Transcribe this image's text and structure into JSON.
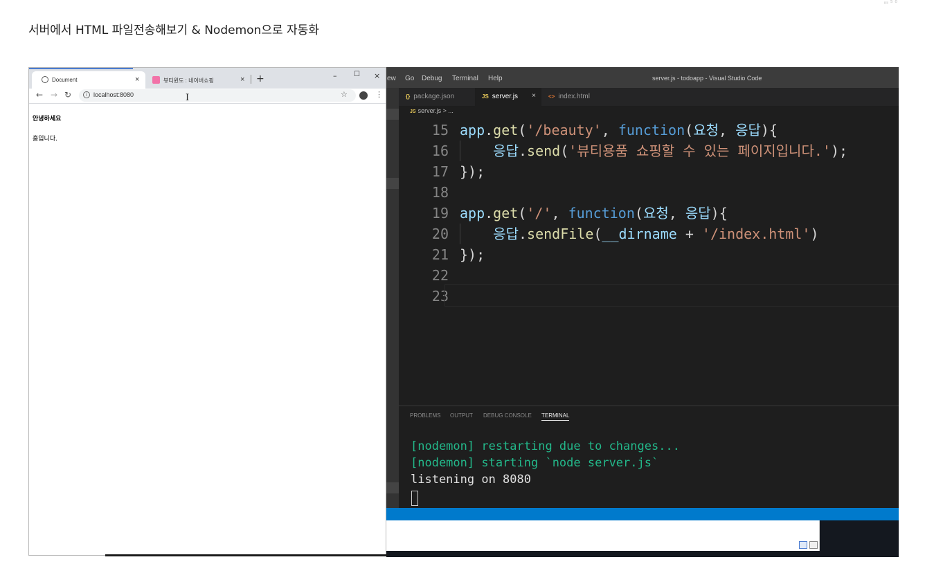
{
  "page": {
    "title": "서버에서 HTML 파일전송해보기 & Nodemon으로 자동화",
    "corner_mark": "፡፡፡ ⁵ ⁰"
  },
  "chrome": {
    "tabs": [
      {
        "label": "Document",
        "icon": "globe-icon",
        "active": true
      },
      {
        "label": "뷰티윈도 : 네이버쇼핑",
        "icon": "naver-shopping-favicon",
        "active": false
      }
    ],
    "url": "localhost:8080",
    "content": {
      "heading": "안녕하세요",
      "paragraph": "홈입니다."
    }
  },
  "vscode": {
    "menu": [
      "ew",
      "Go",
      "Debug",
      "Terminal",
      "Help"
    ],
    "window_title": "server.js - todoapp - Visual Studio Code",
    "tabs": [
      {
        "icon": "{}",
        "label": "package.json",
        "active": false
      },
      {
        "icon": "JS",
        "label": "server.js",
        "active": true
      },
      {
        "icon": "<>",
        "label": "index.html",
        "active": false
      }
    ],
    "breadcrumb": "server.js > ...",
    "breadcrumb_icon": "JS",
    "lines": [
      {
        "num": "15",
        "tokens": [
          [
            "app",
            "var"
          ],
          [
            ".",
            "pun"
          ],
          [
            "get",
            "fn"
          ],
          [
            "(",
            "pun"
          ],
          [
            "'/beauty'",
            "str"
          ],
          [
            ", ",
            "pun"
          ],
          [
            "function",
            "kw"
          ],
          [
            "(",
            "pun"
          ],
          [
            "요청",
            "var"
          ],
          [
            ", ",
            "pun"
          ],
          [
            "응답",
            "var"
          ],
          [
            "){",
            "pun"
          ]
        ]
      },
      {
        "num": "16",
        "tokens": [
          [
            "    ",
            "pun"
          ],
          [
            "응답",
            "var"
          ],
          [
            ".",
            "pun"
          ],
          [
            "send",
            "fn"
          ],
          [
            "(",
            "pun"
          ],
          [
            "'뷰티용품 쇼핑할 수 있는 페이지입니다.'",
            "str"
          ],
          [
            ");",
            "pun"
          ]
        ]
      },
      {
        "num": "17",
        "tokens": [
          [
            "});",
            "pun"
          ]
        ]
      },
      {
        "num": "18",
        "tokens": []
      },
      {
        "num": "19",
        "tokens": [
          [
            "app",
            "var"
          ],
          [
            ".",
            "pun"
          ],
          [
            "get",
            "fn"
          ],
          [
            "(",
            "pun"
          ],
          [
            "'/'",
            "str"
          ],
          [
            ", ",
            "pun"
          ],
          [
            "function",
            "kw"
          ],
          [
            "(",
            "pun"
          ],
          [
            "요청",
            "var"
          ],
          [
            ", ",
            "pun"
          ],
          [
            "응답",
            "var"
          ],
          [
            "){",
            "pun"
          ]
        ]
      },
      {
        "num": "20",
        "tokens": [
          [
            "    ",
            "pun"
          ],
          [
            "응답",
            "var"
          ],
          [
            ".",
            "pun"
          ],
          [
            "sendFile",
            "fn"
          ],
          [
            "(",
            "pun"
          ],
          [
            "__dirname",
            "var"
          ],
          [
            " + ",
            "pun"
          ],
          [
            "'/index.html'",
            "str"
          ],
          [
            ")",
            "pun"
          ]
        ]
      },
      {
        "num": "21",
        "tokens": [
          [
            "});",
            "pun"
          ]
        ]
      },
      {
        "num": "22",
        "tokens": []
      },
      {
        "num": "23",
        "tokens": []
      }
    ],
    "panel_tabs": [
      {
        "label": "PROBLEMS",
        "active": false
      },
      {
        "label": "OUTPUT",
        "active": false
      },
      {
        "label": "DEBUG CONSOLE",
        "active": false
      },
      {
        "label": "TERMINAL",
        "active": true
      }
    ],
    "terminal": [
      {
        "text": "[nodemon] restarting due to changes...",
        "color": "#23b88a"
      },
      {
        "text": "[nodemon] starting `node server.js`",
        "color": "#23b88a"
      },
      {
        "text": "listening on 8080",
        "color": "#e0e0e0"
      }
    ]
  }
}
